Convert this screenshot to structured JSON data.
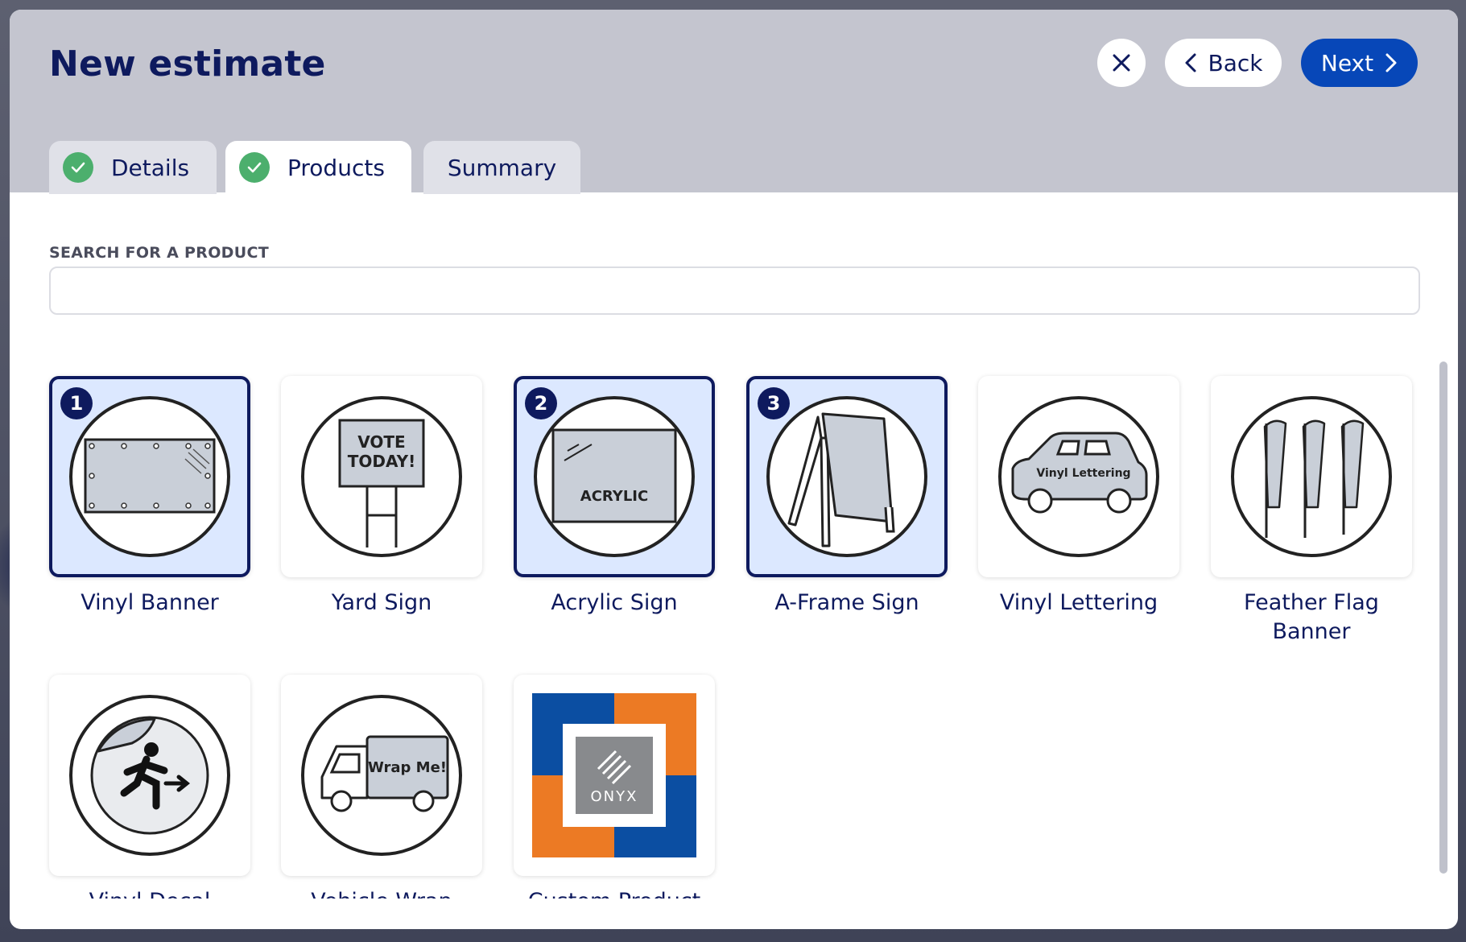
{
  "modal": {
    "title": "New estimate",
    "close_icon": "close-icon",
    "back_label": "Back",
    "next_label": "Next",
    "accent_color": "#0747b8",
    "header_color": "#c4c5cf"
  },
  "tabs": [
    {
      "label": "Details",
      "status": "complete"
    },
    {
      "label": "Products",
      "status": "complete",
      "active": true
    },
    {
      "label": "Summary",
      "status": "pending"
    }
  ],
  "search": {
    "label": "SEARCH FOR A PRODUCT",
    "value": "",
    "placeholder": ""
  },
  "products": [
    {
      "label": "Vinyl Banner",
      "selected": true,
      "order": "1",
      "icon": "vinyl-banner-icon"
    },
    {
      "label": "Yard Sign",
      "selected": false,
      "icon": "yard-sign-icon",
      "icon_text": "VOTE TODAY!"
    },
    {
      "label": "Acrylic Sign",
      "selected": true,
      "order": "2",
      "icon": "acrylic-sign-icon",
      "icon_text": "ACRYLIC"
    },
    {
      "label": "A-Frame Sign",
      "selected": true,
      "order": "3",
      "icon": "a-frame-sign-icon"
    },
    {
      "label": "Vinyl Lettering",
      "selected": false,
      "icon": "vinyl-lettering-icon",
      "icon_text": "Vinyl Lettering"
    },
    {
      "label": "Feather Flag Banner",
      "selected": false,
      "icon": "feather-flag-icon"
    },
    {
      "label": "Vinyl Decal",
      "selected": false,
      "icon": "vinyl-decal-icon"
    },
    {
      "label": "Vehicle Wrap",
      "selected": false,
      "icon": "vehicle-wrap-icon",
      "icon_text": "Wrap Me!"
    },
    {
      "label": "Custom Product",
      "selected": false,
      "icon": "onyx-logo-icon",
      "icon_text": "ONYX"
    }
  ]
}
